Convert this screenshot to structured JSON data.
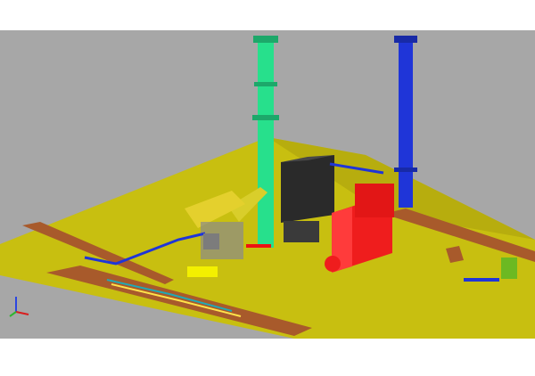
{
  "viewer": {
    "background_color": "#a7a7a7",
    "page_background_color": "#ffffff"
  },
  "scene": {
    "ground_color": "#c8bf10",
    "road_color": "#a85a2b",
    "stack_left_color": "#27e08c",
    "stack_right_color": "#1f35d8",
    "hrsg_color": "#ef1d1d",
    "building_color": "#2a2a2a",
    "duct_color": "#d9ce2b",
    "pipe_color": "#20a9b5"
  },
  "axis_triad": {
    "x_color": "#d91e1e",
    "y_color": "#2fb52f",
    "z_color": "#2b46e0"
  }
}
